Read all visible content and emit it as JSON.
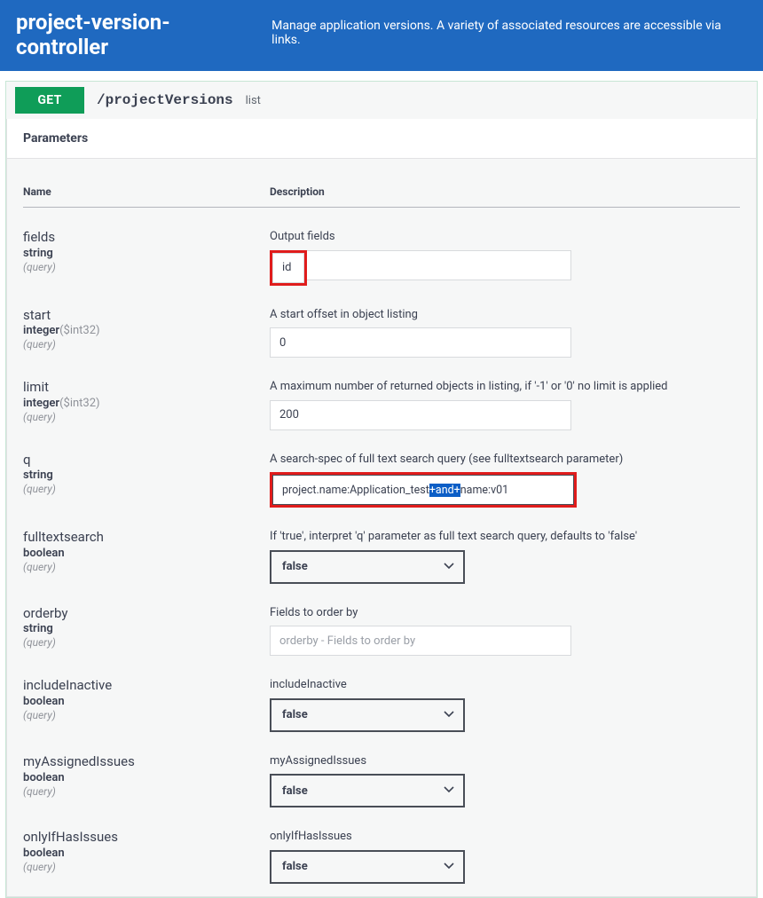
{
  "header": {
    "title": "project-version-controller",
    "subtitle": "Manage application versions. A variety of associated resources are accessible via links."
  },
  "operation": {
    "method": "GET",
    "path": "/projectVersions",
    "summary": "list"
  },
  "params_heading": "Parameters",
  "table_headers": {
    "name": "Name",
    "description": "Description"
  },
  "in_query": "(query)",
  "params": {
    "fields": {
      "name": "fields",
      "type": "string",
      "desc": "Output fields",
      "value": "id"
    },
    "start": {
      "name": "start",
      "type": "integer",
      "format": "($int32)",
      "desc": "A start offset in object listing",
      "value": "0"
    },
    "limit": {
      "name": "limit",
      "type": "integer",
      "format": "($int32)",
      "desc": "A maximum number of returned objects in listing, if '-1' or '0' no limit is applied",
      "value": "200"
    },
    "q": {
      "name": "q",
      "type": "string",
      "desc": "A search-spec of full text search query (see fulltextsearch parameter)",
      "value_prefix": "project.name:Application_test",
      "value_highlight": "+and+",
      "value_suffix": "name:v01"
    },
    "fulltextsearch": {
      "name": "fulltextsearch",
      "type": "boolean",
      "desc": "If 'true', interpret 'q' parameter as full text search query, defaults to 'false'",
      "value": "false"
    },
    "orderby": {
      "name": "orderby",
      "type": "string",
      "desc": "Fields to order by",
      "placeholder": "orderby - Fields to order by"
    },
    "includeInactive": {
      "name": "includeInactive",
      "type": "boolean",
      "desc": "includeInactive",
      "value": "false"
    },
    "myAssignedIssues": {
      "name": "myAssignedIssues",
      "type": "boolean",
      "desc": "myAssignedIssues",
      "value": "false"
    },
    "onlyIfHasIssues": {
      "name": "onlyIfHasIssues",
      "type": "boolean",
      "desc": "onlyIfHasIssues",
      "value": "false"
    }
  }
}
